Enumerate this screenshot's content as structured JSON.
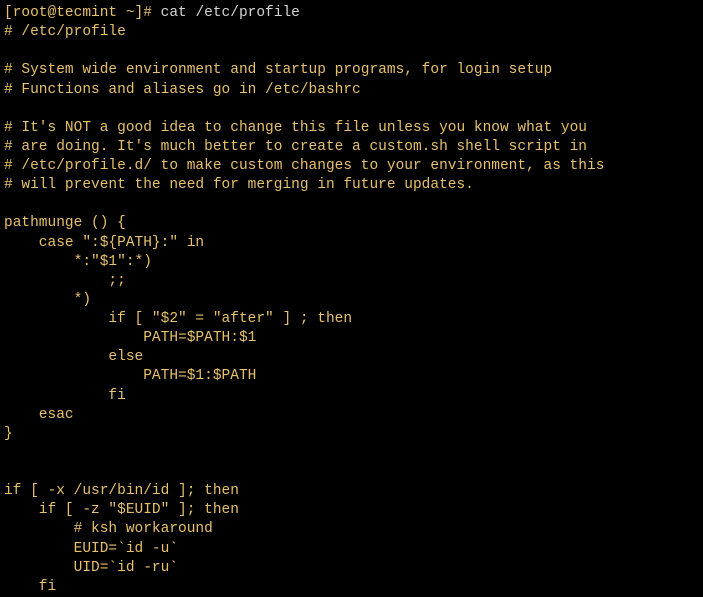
{
  "terminal": {
    "prompt": "[root@tecmint ~]# ",
    "command": "cat /etc/profile",
    "line01": "# /etc/profile",
    "line02": "",
    "line03": "# System wide environment and startup programs, for login setup",
    "line04": "# Functions and aliases go in /etc/bashrc",
    "line05": "",
    "line06": "# It's NOT a good idea to change this file unless you know what you",
    "line07": "# are doing. It's much better to create a custom.sh shell script in",
    "line08": "# /etc/profile.d/ to make custom changes to your environment, as this",
    "line09": "# will prevent the need for merging in future updates.",
    "line10": "",
    "line11": "pathmunge () {",
    "line12": "    case \":${PATH}:\" in",
    "line13": "        *:\"$1\":*)",
    "line14": "            ;;",
    "line15": "        *)",
    "line16": "            if [ \"$2\" = \"after\" ] ; then",
    "line17": "                PATH=$PATH:$1",
    "line18": "            else",
    "line19": "                PATH=$1:$PATH",
    "line20": "            fi",
    "line21": "    esac",
    "line22": "}",
    "line23": "",
    "line24": "",
    "line25": "if [ -x /usr/bin/id ]; then",
    "line26": "    if [ -z \"$EUID\" ]; then",
    "line27": "        # ksh workaround",
    "line28": "        EUID=`id -u`",
    "line29": "        UID=`id -ru`",
    "line30": "    fi"
  }
}
